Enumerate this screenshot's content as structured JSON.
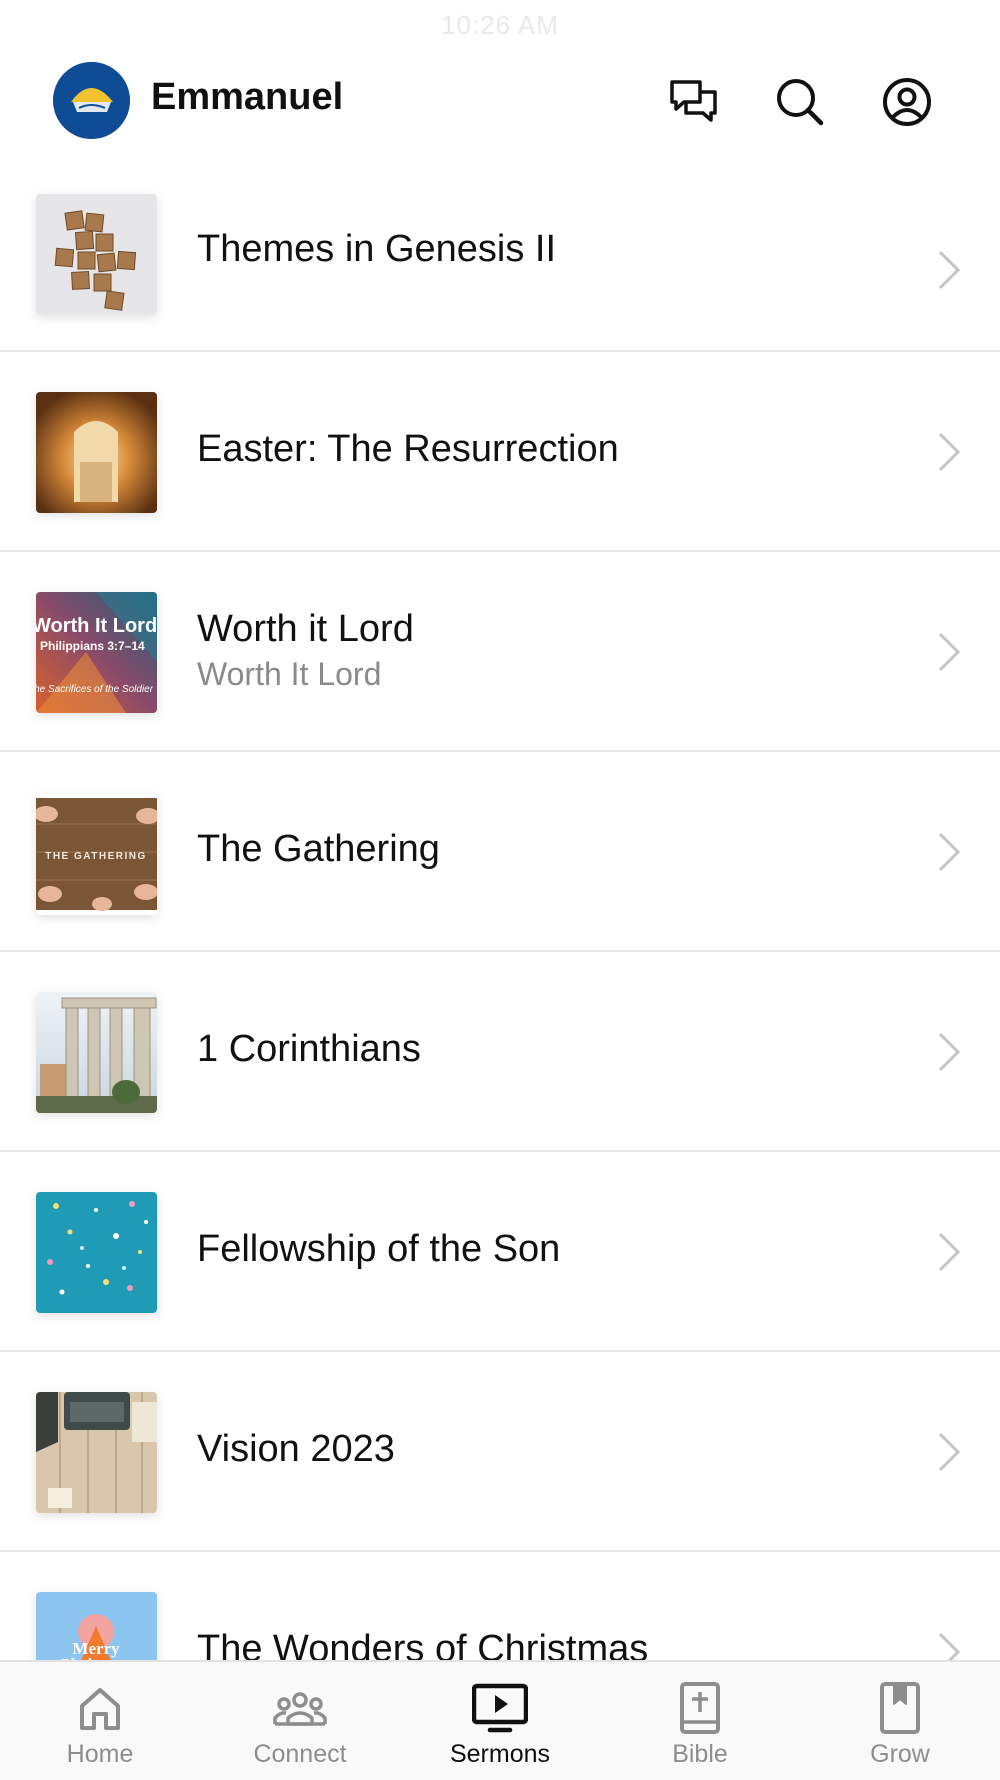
{
  "status_bar": {
    "time": "10:26 AM"
  },
  "header": {
    "title": "Emmanuel"
  },
  "sermons": [
    {
      "title": "Themes in Genesis II",
      "subtitle": ""
    },
    {
      "title": "Easter:  The Resurrection",
      "subtitle": ""
    },
    {
      "title": "Worth it Lord",
      "subtitle": "Worth It Lord"
    },
    {
      "title": "The Gathering",
      "subtitle": ""
    },
    {
      "title": "1 Corinthians",
      "subtitle": ""
    },
    {
      "title": "Fellowship of the Son",
      "subtitle": ""
    },
    {
      "title": "Vision 2023",
      "subtitle": ""
    },
    {
      "title": "The Wonders of Christmas",
      "subtitle": ""
    }
  ],
  "thumb_text": {
    "worth_line1": "Worth It Lord",
    "worth_line2": "Philippians 3:7–14",
    "worth_line3": "The Sacrifices of the Soldier",
    "gathering": "THE GATHERING",
    "christmas1": "Merry",
    "christmas2": "Christmas"
  },
  "tabs": [
    {
      "label": "Home",
      "icon": "home-icon",
      "active": false
    },
    {
      "label": "Connect",
      "icon": "people-icon",
      "active": false
    },
    {
      "label": "Sermons",
      "icon": "tv-play-icon",
      "active": true
    },
    {
      "label": "Bible",
      "icon": "bible-icon",
      "active": false
    },
    {
      "label": "Grow",
      "icon": "bookmark-book-icon",
      "active": false
    }
  ],
  "colors": {
    "accent": "#111111",
    "inactive": "#8d8d8d",
    "logo_bg": "#0f4c96"
  }
}
